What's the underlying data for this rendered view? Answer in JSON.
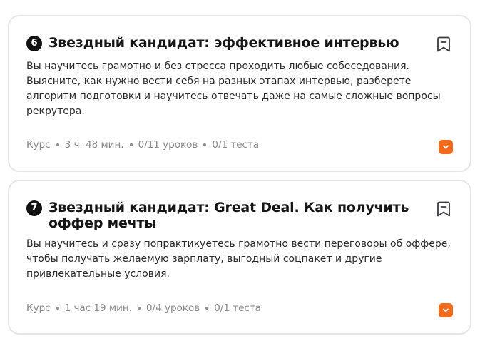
{
  "colors": {
    "accent": "#f26b1d",
    "badge": "#111111",
    "border": "#e6e6e8",
    "meta_text": "#8a8a90"
  },
  "cards": [
    {
      "number": "6",
      "title": "Звездный кандидат: эффективное интервью",
      "description": "Вы научитесь грамотно и без стресса проходить любые собеседования. Выясните, как нужно вести себя на разных этапах интервью, разберете алгоритм подготовки и научитесь отвечать даже на самые сложные вопросы рекрутера.",
      "meta": {
        "type": "Курс",
        "duration": "3 ч. 48 мин.",
        "lessons": "0/11 уроков",
        "tests": "0/1 теста"
      },
      "bookmark_icon": "bookmark-icon",
      "expand_icon": "chevron-down-icon"
    },
    {
      "number": "7",
      "title": "Звездный кандидат: Great Deal. Как получить оффер мечты",
      "description": "Вы научитесь и сразу попрактикуетесь грамотно вести переговоры об оффере, чтобы получать желаемую зарплату, выгодный соцпакет и другие привлекательные условия.",
      "meta": {
        "type": "Курс",
        "duration": "1 час 19 мин.",
        "lessons": "0/4 уроков",
        "tests": "0/1 теста"
      },
      "bookmark_icon": "bookmark-icon",
      "expand_icon": "chevron-down-icon"
    }
  ]
}
